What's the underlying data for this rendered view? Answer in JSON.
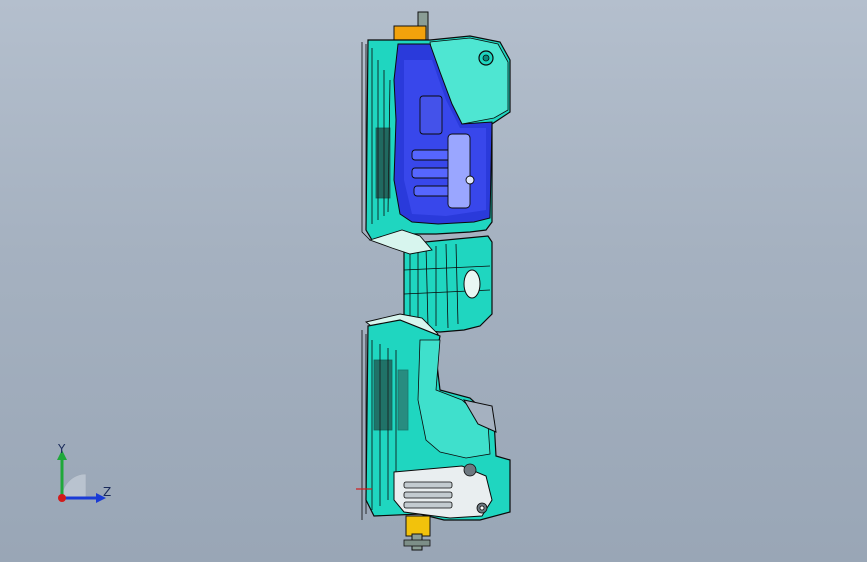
{
  "view": {
    "triad": {
      "y_label": "Y",
      "z_label": "Z",
      "colors": {
        "y_axis": "#1fa83a",
        "z_axis": "#1a3bd6",
        "x_axis": "#d21a1a"
      }
    },
    "model": {
      "part_color": "#1fd6c0",
      "highlight_color": "#2a3adb",
      "edge_color": "#0a0a0a",
      "fixture_color": "#f2a20c"
    }
  }
}
